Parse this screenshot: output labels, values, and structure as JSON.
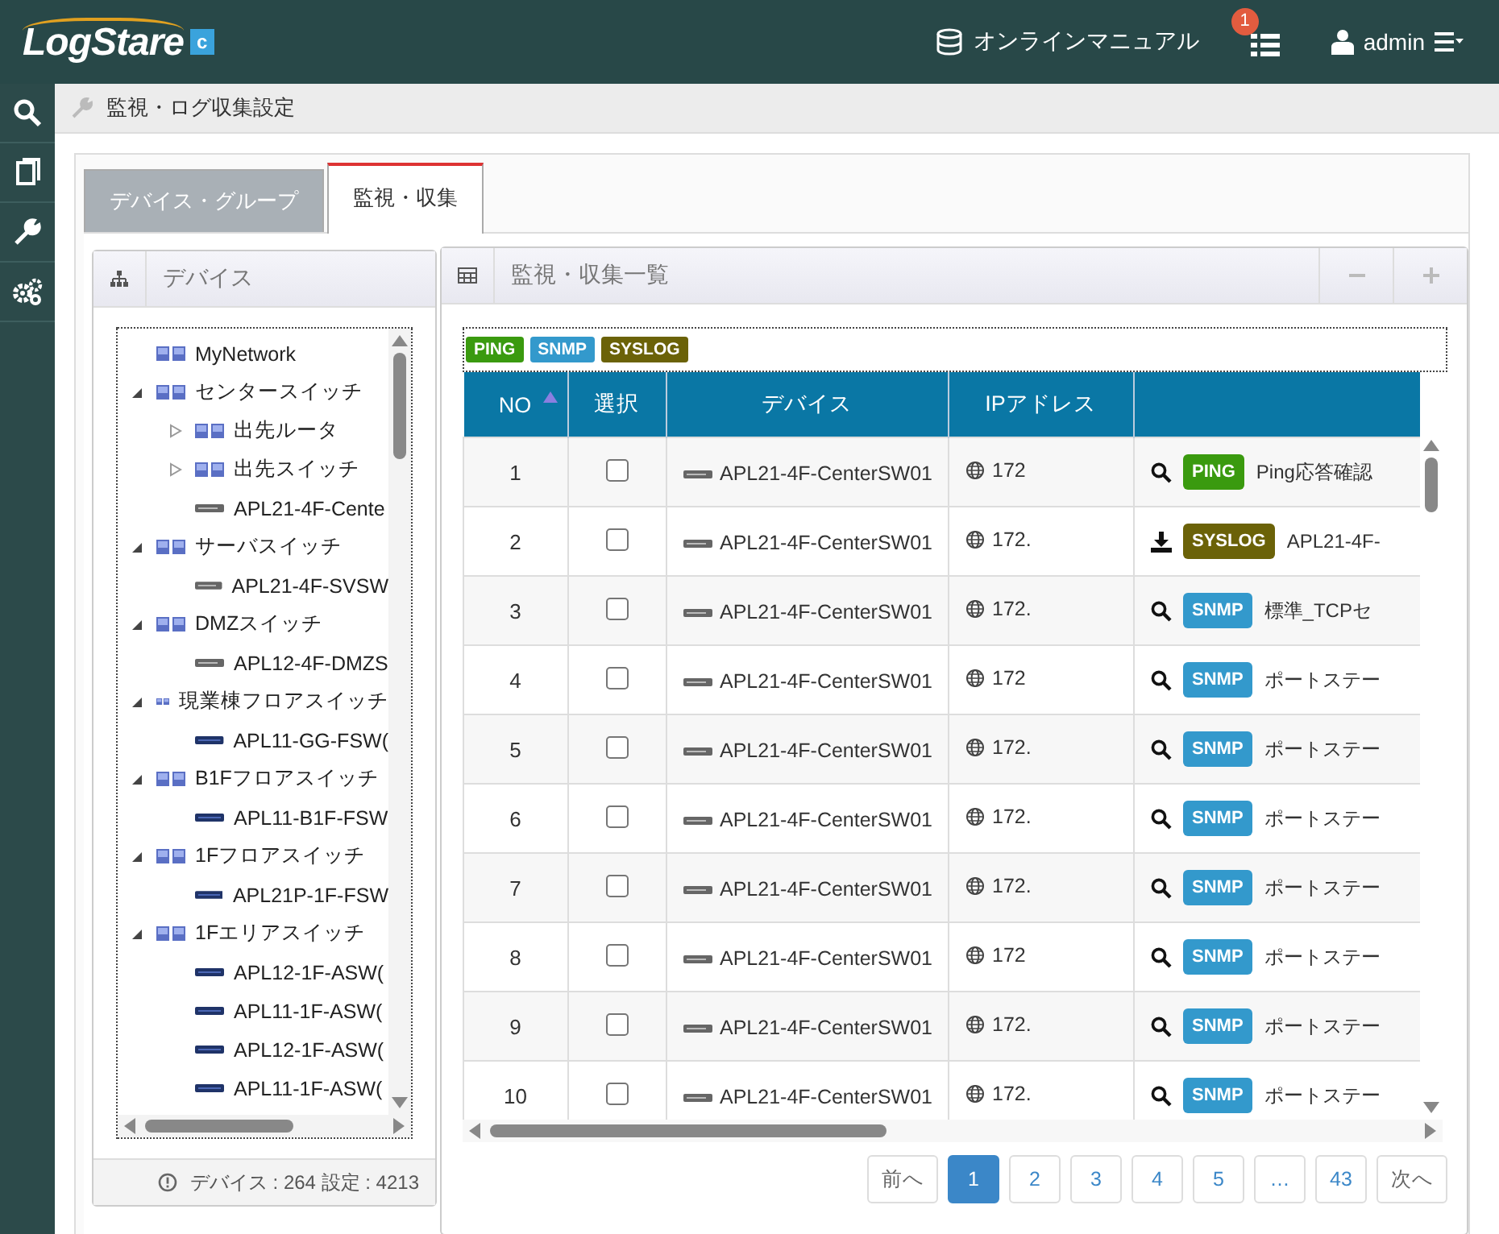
{
  "header": {
    "logo": "LogStare",
    "logo_badge": "c",
    "manual_link": "オンラインマニュアル",
    "notification_count": "1",
    "user": "admin"
  },
  "sidebar": {
    "items": [
      {
        "kind": "search",
        "selected": false
      },
      {
        "kind": "book",
        "selected": false
      },
      {
        "kind": "wrench",
        "selected": false
      },
      {
        "kind": "gears",
        "selected": false
      }
    ]
  },
  "breadcrumb": "監視・ログ収集設定",
  "tabs": [
    {
      "label": "デバイス・グループ",
      "selected": false
    },
    {
      "label": "監視・収集",
      "selected": true
    }
  ],
  "device_panel": {
    "title": "デバイス",
    "tree": [
      {
        "label": "MyNetwork",
        "kind": "group"
      },
      {
        "label": "センタースイッチ",
        "kind": "group",
        "expanded": true,
        "children": [
          {
            "label": "出先ルータ",
            "kind": "group",
            "expanded": false
          },
          {
            "label": "出先スイッチ",
            "kind": "group",
            "expanded": false
          },
          {
            "label": "APL21-4F-Cente",
            "kind": "router"
          }
        ]
      },
      {
        "label": "サーバスイッチ",
        "kind": "group",
        "expanded": true,
        "children": [
          {
            "label": "APL21-4F-SVSW",
            "kind": "router"
          }
        ]
      },
      {
        "label": "DMZスイッチ",
        "kind": "group",
        "expanded": true,
        "children": [
          {
            "label": "APL12-4F-DMZS",
            "kind": "router"
          }
        ]
      },
      {
        "label": "現業棟フロアスイッチ",
        "kind": "group",
        "expanded": true,
        "children": [
          {
            "label": "APL11-GG-FSW(",
            "kind": "switch"
          }
        ]
      },
      {
        "label": "B1Fフロアスイッチ",
        "kind": "group",
        "expanded": true,
        "children": [
          {
            "label": "APL11-B1F-FSW",
            "kind": "switch"
          }
        ]
      },
      {
        "label": "1Fフロアスイッチ",
        "kind": "group",
        "expanded": true,
        "children": [
          {
            "label": "APL21P-1F-FSW",
            "kind": "switch"
          }
        ]
      },
      {
        "label": "1Fエリアスイッチ",
        "kind": "group",
        "expanded": true,
        "children": [
          {
            "label": "APL12-1F-ASW(",
            "kind": "switch"
          },
          {
            "label": "APL11-1F-ASW(",
            "kind": "switch"
          },
          {
            "label": "APL12-1F-ASW(",
            "kind": "switch"
          },
          {
            "label": "APL11-1F-ASW(",
            "kind": "switch"
          }
        ]
      }
    ],
    "footer": "デバイス : 264  設定 : 4213"
  },
  "monitor_panel": {
    "title": "監視・収集一覧",
    "legend": [
      {
        "label": "PING",
        "color": "#3a9a0f"
      },
      {
        "label": "SNMP",
        "color": "#3399cc"
      },
      {
        "label": "SYSLOG",
        "color": "#6b6208"
      }
    ],
    "table": {
      "columns": [
        "NO",
        "選択",
        "デバイス",
        "IPアドレス"
      ],
      "rows": [
        {
          "no": "1",
          "checked": false,
          "device": "APL21-4F-CenterSW01",
          "ip": "172",
          "kind": "search",
          "tag": {
            "label": "PING",
            "color": "#3a9a0f"
          },
          "name": "Ping応答確認"
        },
        {
          "no": "2",
          "checked": false,
          "device": "APL21-4F-CenterSW01",
          "ip": "172.",
          "kind": "download",
          "tag": {
            "label": "SYSLOG",
            "color": "#6b6208"
          },
          "name": "APL21-4F-"
        },
        {
          "no": "3",
          "checked": false,
          "device": "APL21-4F-CenterSW01",
          "ip": "172.",
          "kind": "search",
          "tag": {
            "label": "SNMP",
            "color": "#3399cc"
          },
          "name": "標準_TCPセ"
        },
        {
          "no": "4",
          "checked": false,
          "device": "APL21-4F-CenterSW01",
          "ip": "172",
          "kind": "search",
          "tag": {
            "label": "SNMP",
            "color": "#3399cc"
          },
          "name": "ポートステー"
        },
        {
          "no": "5",
          "checked": false,
          "device": "APL21-4F-CenterSW01",
          "ip": "172.",
          "kind": "search",
          "tag": {
            "label": "SNMP",
            "color": "#3399cc"
          },
          "name": "ポートステー"
        },
        {
          "no": "6",
          "checked": false,
          "device": "APL21-4F-CenterSW01",
          "ip": "172.",
          "kind": "search",
          "tag": {
            "label": "SNMP",
            "color": "#3399cc"
          },
          "name": "ポートステー"
        },
        {
          "no": "7",
          "checked": false,
          "device": "APL21-4F-CenterSW01",
          "ip": "172.",
          "kind": "search",
          "tag": {
            "label": "SNMP",
            "color": "#3399cc"
          },
          "name": "ポートステー"
        },
        {
          "no": "8",
          "checked": false,
          "device": "APL21-4F-CenterSW01",
          "ip": "172",
          "kind": "search",
          "tag": {
            "label": "SNMP",
            "color": "#3399cc"
          },
          "name": "ポートステー"
        },
        {
          "no": "9",
          "checked": false,
          "device": "APL21-4F-CenterSW01",
          "ip": "172.",
          "kind": "search",
          "tag": {
            "label": "SNMP",
            "color": "#3399cc"
          },
          "name": "ポートステー"
        },
        {
          "no": "10",
          "checked": false,
          "device": "APL21-4F-CenterSW01",
          "ip": "172.",
          "kind": "search",
          "tag": {
            "label": "SNMP",
            "color": "#3399cc"
          },
          "name": "ポートステー"
        }
      ]
    },
    "pagination": {
      "prev": "前へ",
      "next": "次へ",
      "pages": [
        {
          "label": "1",
          "selected": true
        },
        {
          "label": "2",
          "selected": false
        },
        {
          "label": "3",
          "selected": false
        },
        {
          "label": "4",
          "selected": false
        },
        {
          "label": "5",
          "selected": false
        },
        {
          "label": "…",
          "selected": false
        },
        {
          "label": "43",
          "selected": false
        }
      ]
    }
  }
}
